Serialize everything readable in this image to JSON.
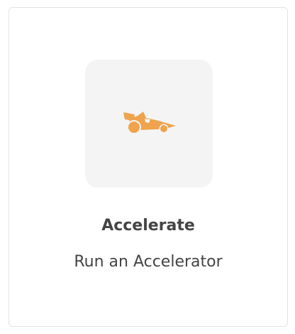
{
  "card": {
    "title": "Accelerate",
    "subtitle": "Run an Accelerator",
    "icon": "race-car-icon",
    "colors": {
      "icon": "#eea34c",
      "tile_background": "#f4f4f4",
      "border": "#e3e3e3",
      "text": "#444444"
    }
  }
}
